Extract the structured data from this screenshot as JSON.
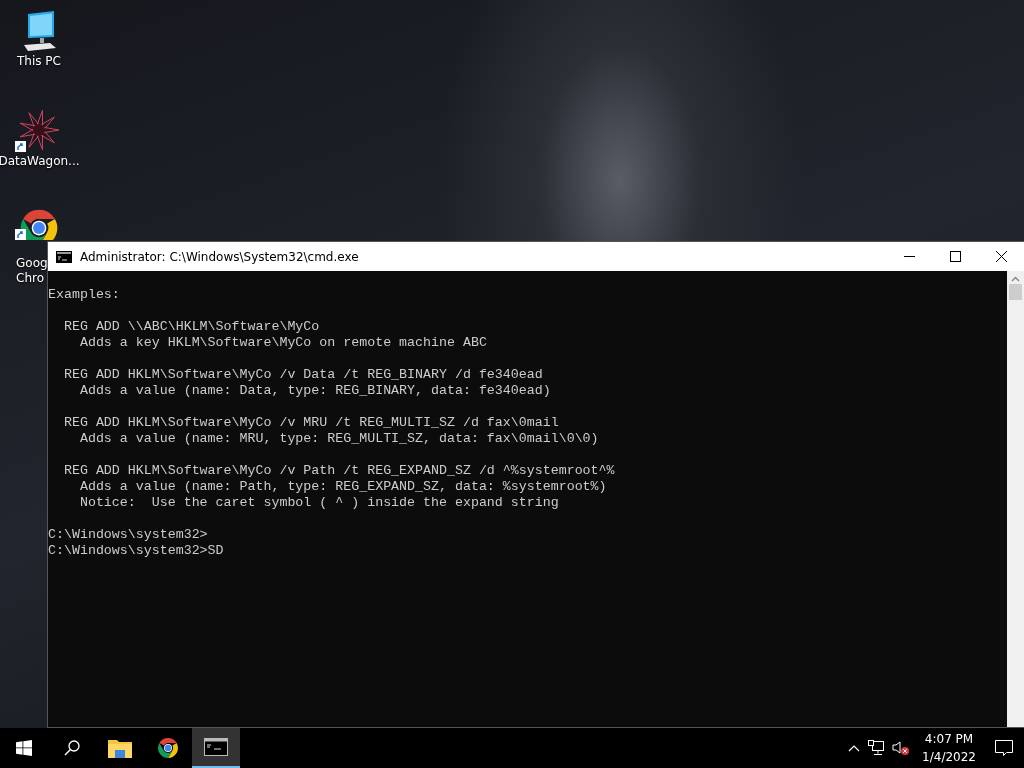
{
  "desktop_icons": [
    {
      "kind": "pc",
      "label_lines": [
        "This PC"
      ],
      "shortcut": false
    },
    {
      "kind": "star",
      "label_lines": [
        "DataWagon..."
      ],
      "shortcut": true
    },
    {
      "kind": "chrome",
      "label_lines": [
        "Goog",
        "Chro"
      ],
      "shortcut": true
    }
  ],
  "window": {
    "title": "Administrator: C:\\Windows\\System32\\cmd.exe",
    "console_blocks": [
      [
        "Examples:"
      ],
      [
        "  REG ADD \\\\ABC\\HKLM\\Software\\MyCo",
        "    Adds a key HKLM\\Software\\MyCo on remote machine ABC"
      ],
      [
        "  REG ADD HKLM\\Software\\MyCo /v Data /t REG_BINARY /d fe340ead",
        "    Adds a value (name: Data, type: REG_BINARY, data: fe340ead)"
      ],
      [
        "  REG ADD HKLM\\Software\\MyCo /v MRU /t REG_MULTI_SZ /d fax\\0mail",
        "    Adds a value (name: MRU, type: REG_MULTI_SZ, data: fax\\0mail\\0\\0)"
      ],
      [
        "  REG ADD HKLM\\Software\\MyCo /v Path /t REG_EXPAND_SZ /d ^%systemroot^%",
        "    Adds a value (name: Path, type: REG_EXPAND_SZ, data: %systemroot%)",
        "    Notice:  Use the caret symbol ( ^ ) inside the expand string"
      ],
      [
        "C:\\Windows\\system32>",
        "C:\\Windows\\system32>SD"
      ]
    ]
  },
  "taskbar": {
    "apps": [
      {
        "kind": "explorer",
        "selected": false
      },
      {
        "kind": "chrome",
        "selected": false
      },
      {
        "kind": "cmd",
        "selected": true
      }
    ],
    "time": "4:07 PM",
    "date": "1/4/2022"
  }
}
